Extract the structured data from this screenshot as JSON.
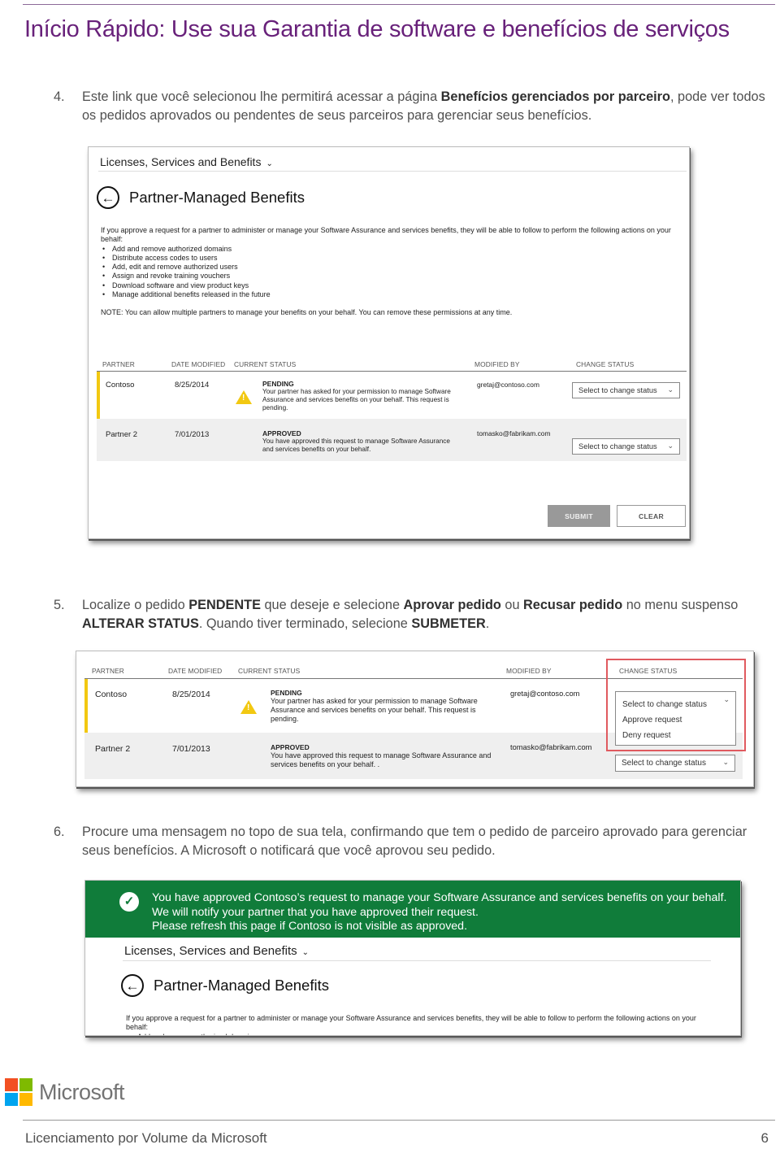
{
  "header": {
    "title_lead": "Início Rápido:",
    "title_rest": " Use sua Garantia de software e benefícios de serviços"
  },
  "steps": [
    {
      "number": "4.",
      "parts": [
        {
          "t": "Este link que você selecionou lhe permitirá acessar a página ",
          "b": false
        },
        {
          "t": "Benefícios gerenciados por parceiro",
          "b": true
        },
        {
          "t": ", pode ver todos os pedidos aprovados ou pendentes de seus parceiros para gerenciar seus benefícios.",
          "b": false
        }
      ]
    },
    {
      "number": "5.",
      "parts": [
        {
          "t": "Localize o pedido ",
          "b": false
        },
        {
          "t": "PENDENTE",
          "b": true
        },
        {
          "t": " que deseje e selecione ",
          "b": false
        },
        {
          "t": "Aprovar pedido",
          "b": true
        },
        {
          "t": " ou ",
          "b": false
        },
        {
          "t": "Recusar pedido",
          "b": true
        },
        {
          "t": " no menu suspenso ",
          "b": false
        },
        {
          "t": "ALTERAR STATUS",
          "b": true
        },
        {
          "t": ". Quando tiver terminado, selecione ",
          "b": false
        },
        {
          "t": "SUBMETER",
          "b": true
        },
        {
          "t": ".",
          "b": false
        }
      ]
    },
    {
      "number": "6.",
      "parts": [
        {
          "t": "Procure uma mensagem no topo de sua tela, confirmando que tem o pedido de parceiro aprovado para gerenciar seus benefícios. A Microsoft o notificará que você aprovou seu pedido.",
          "b": false
        }
      ]
    }
  ],
  "portal": {
    "breadcrumb": "Licenses, Services and Benefits",
    "page_title": "Partner-Managed Benefits",
    "intro": "If you approve a request for a partner to administer or manage your Software Assurance and services benefits, they will be able to follow to perform the following actions on your behalf:",
    "actions": [
      "Add and remove authorized domains",
      "Distribute access codes to users",
      "Add, edit and remove authorized users",
      "Assign and revoke training vouchers",
      "Download software and view product keys",
      "Manage additional benefits released in the future"
    ],
    "note": "NOTE: You can allow multiple partners to manage your benefits on your behalf. You can remove these permissions at any time.",
    "columns": [
      "PARTNER",
      "DATE MODIFIED",
      "CURRENT STATUS",
      "MODIFIED BY",
      "CHANGE STATUS"
    ],
    "rows": [
      {
        "partner": "Contoso",
        "date": "8/25/2014",
        "status_title": "PENDING",
        "status_desc": "Your partner has asked for your  permission to manage Software Assurance and services benefits on your behalf.  This request is pending.",
        "modified_by": "gretaj@contoso.com",
        "select_value": "Select to change status"
      },
      {
        "partner": "Partner 2",
        "date": "7/01/2013",
        "status_title": "APPROVED",
        "status_desc": "You have approved this request to manage Software Assurance and services benefits on your behalf.",
        "status_desc_alt": "You have approved this request to manage Software Assurance and services benefits on your behalf. .",
        "modified_by": "tomasko@fabrikam.com",
        "select_value": "Select to change status"
      }
    ],
    "dropdown_options": [
      "Select to change status",
      "Approve request",
      "Deny request"
    ],
    "submit_label": "SUBMIT",
    "clear_label": "CLEAR",
    "banner_lines": [
      "You have approved Contoso’s request to manage your Software Assurance and services benefits on your behalf.",
      "We will notify your partner that you have approved their request.",
      "Please refresh this page if Contoso is not visible as approved."
    ],
    "partial_first_action": "Add and remove authorized domains"
  },
  "footer": {
    "logo_text": "Microsoft",
    "logo_colors": [
      "#f25022",
      "#7fba00",
      "#00a4ef",
      "#ffb900"
    ],
    "doc_title": "Licenciamento por Volume da Microsoft",
    "page_number": "6"
  },
  "colors": {
    "title": "#68217a",
    "banner": "#107c3a",
    "pending_flag": "#f2c811",
    "highlight": "#e05a5f"
  }
}
